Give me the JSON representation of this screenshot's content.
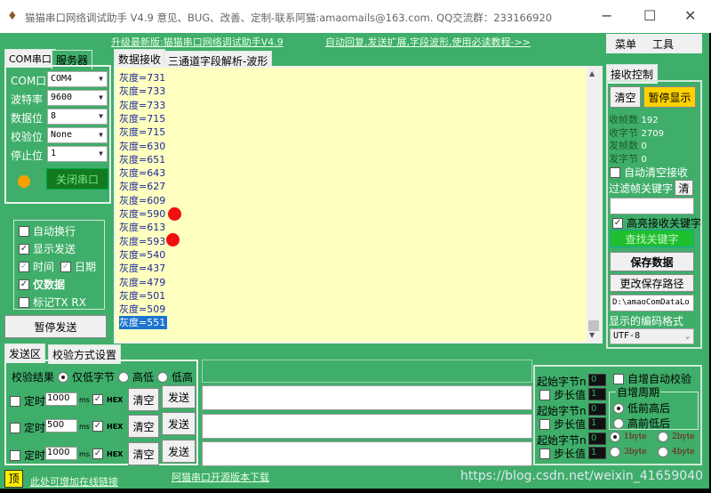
{
  "window": {
    "title": "猫猫串口网络调试助手 V4.9 意见、BUG、改善、定制-联系阿猫:amaomails@163.com. QQ交流群：233166920",
    "minimize": "−",
    "maximize": "☐",
    "close": "✕"
  },
  "top_links": {
    "upgrade": "升级最新版:猫猫串口网络调试助手V4.9",
    "auto_reply": "自动回复,发送扩展,字段波形,使用必读教程->>"
  },
  "menu": {
    "menu": "菜单",
    "tools": "工具"
  },
  "left_tabs": [
    "COM串口",
    "服务器"
  ],
  "serial": {
    "fields": [
      {
        "label": "COM口",
        "value": "COM4"
      },
      {
        "label": "波特率",
        "value": "9600"
      },
      {
        "label": "数据位",
        "value": "8"
      },
      {
        "label": "校验位",
        "value": "None"
      },
      {
        "label": "停止位",
        "value": "1"
      }
    ],
    "status_color": "#f5a000",
    "close_button": "关闭串口"
  },
  "options": [
    {
      "label": "自动换行",
      "checked": false
    },
    {
      "label": "显示发送",
      "checked": true
    },
    {
      "label": "时间",
      "checked": true
    },
    {
      "label": "日期",
      "checked": true
    },
    {
      "label": "仅数据",
      "checked": true
    },
    {
      "label": "标记TX RX",
      "checked": false
    }
  ],
  "pause_send": "暂停发送",
  "data_tabs": [
    "数据接收",
    "三通道字段解析-波形"
  ],
  "receive_lines": [
    "灰度=731",
    "灰度=733",
    "灰度=733",
    "灰度=715",
    "灰度=715",
    "灰度=630",
    "灰度=651",
    "灰度=643",
    "灰度=627",
    "灰度=609",
    "灰度=590",
    "灰度=613",
    "灰度=593",
    "灰度=540",
    "灰度=437",
    "灰度=479",
    "灰度=501",
    "灰度=509",
    "灰度=551"
  ],
  "receive_control": {
    "tab": "接收控制",
    "clear": "清空",
    "pause_display": "暂停显示",
    "stats": [
      {
        "label": "收帧数",
        "value": "192"
      },
      {
        "label": "收字节",
        "value": "2709"
      },
      {
        "label": "发帧数",
        "value": "0"
      },
      {
        "label": "发字节",
        "value": "0"
      }
    ],
    "auto_clear": "自动清空接收",
    "filter_label": "过滤帧关键字",
    "filter_clear": "清",
    "filter_value": "",
    "highlight": "高亮接收关键字",
    "find_keyword": "查找关键字",
    "save_data": "保存数据",
    "change_path": "更改保存路径",
    "path": "D:\\amaoComDataLo",
    "encoding_label": "显示的编码格式",
    "encoding": "UTF-8"
  },
  "send_tabs": [
    "发送区",
    "校验方式设置"
  ],
  "checksum": {
    "label": "校验结果",
    "options": [
      "仅低字节",
      "高低",
      "低高"
    ],
    "selected": 0
  },
  "send_rows": [
    {
      "timer_label": "定时",
      "interval": "1000",
      "unit": "ms",
      "hex": "HEX",
      "clear": "清空",
      "send": "发送",
      "content": ""
    },
    {
      "timer_label": "定时",
      "interval": "500",
      "unit": "ms",
      "hex": "HEX",
      "clear": "清空",
      "send": "发送",
      "content": ""
    },
    {
      "timer_label": "定时",
      "interval": "1000",
      "unit": "ms",
      "hex": "HEX",
      "clear": "清空",
      "send": "发送",
      "content": ""
    }
  ],
  "increment": {
    "rows": [
      {
        "start_label": "起始字节n",
        "start": "0",
        "step_label": "步长值",
        "step": "1"
      },
      {
        "start_label": "起始字节n",
        "start": "0",
        "step_label": "步长值",
        "step": "1"
      },
      {
        "start_label": "起始字节n",
        "start": "0",
        "step_label": "步长值",
        "step": "1"
      }
    ],
    "auto_check": "自增自动校验",
    "period_label": "自增周期",
    "period_options": [
      "低前高后",
      "高前低后"
    ],
    "byte_options": [
      "1byte",
      "2byte",
      "3byte",
      "4byte"
    ]
  },
  "footer": {
    "top": "顶",
    "link": "此处可增加在线链接",
    "download": "阿猫串口开源版本下载",
    "watermark": "https://blog.csdn.net/weixin_41659040"
  }
}
